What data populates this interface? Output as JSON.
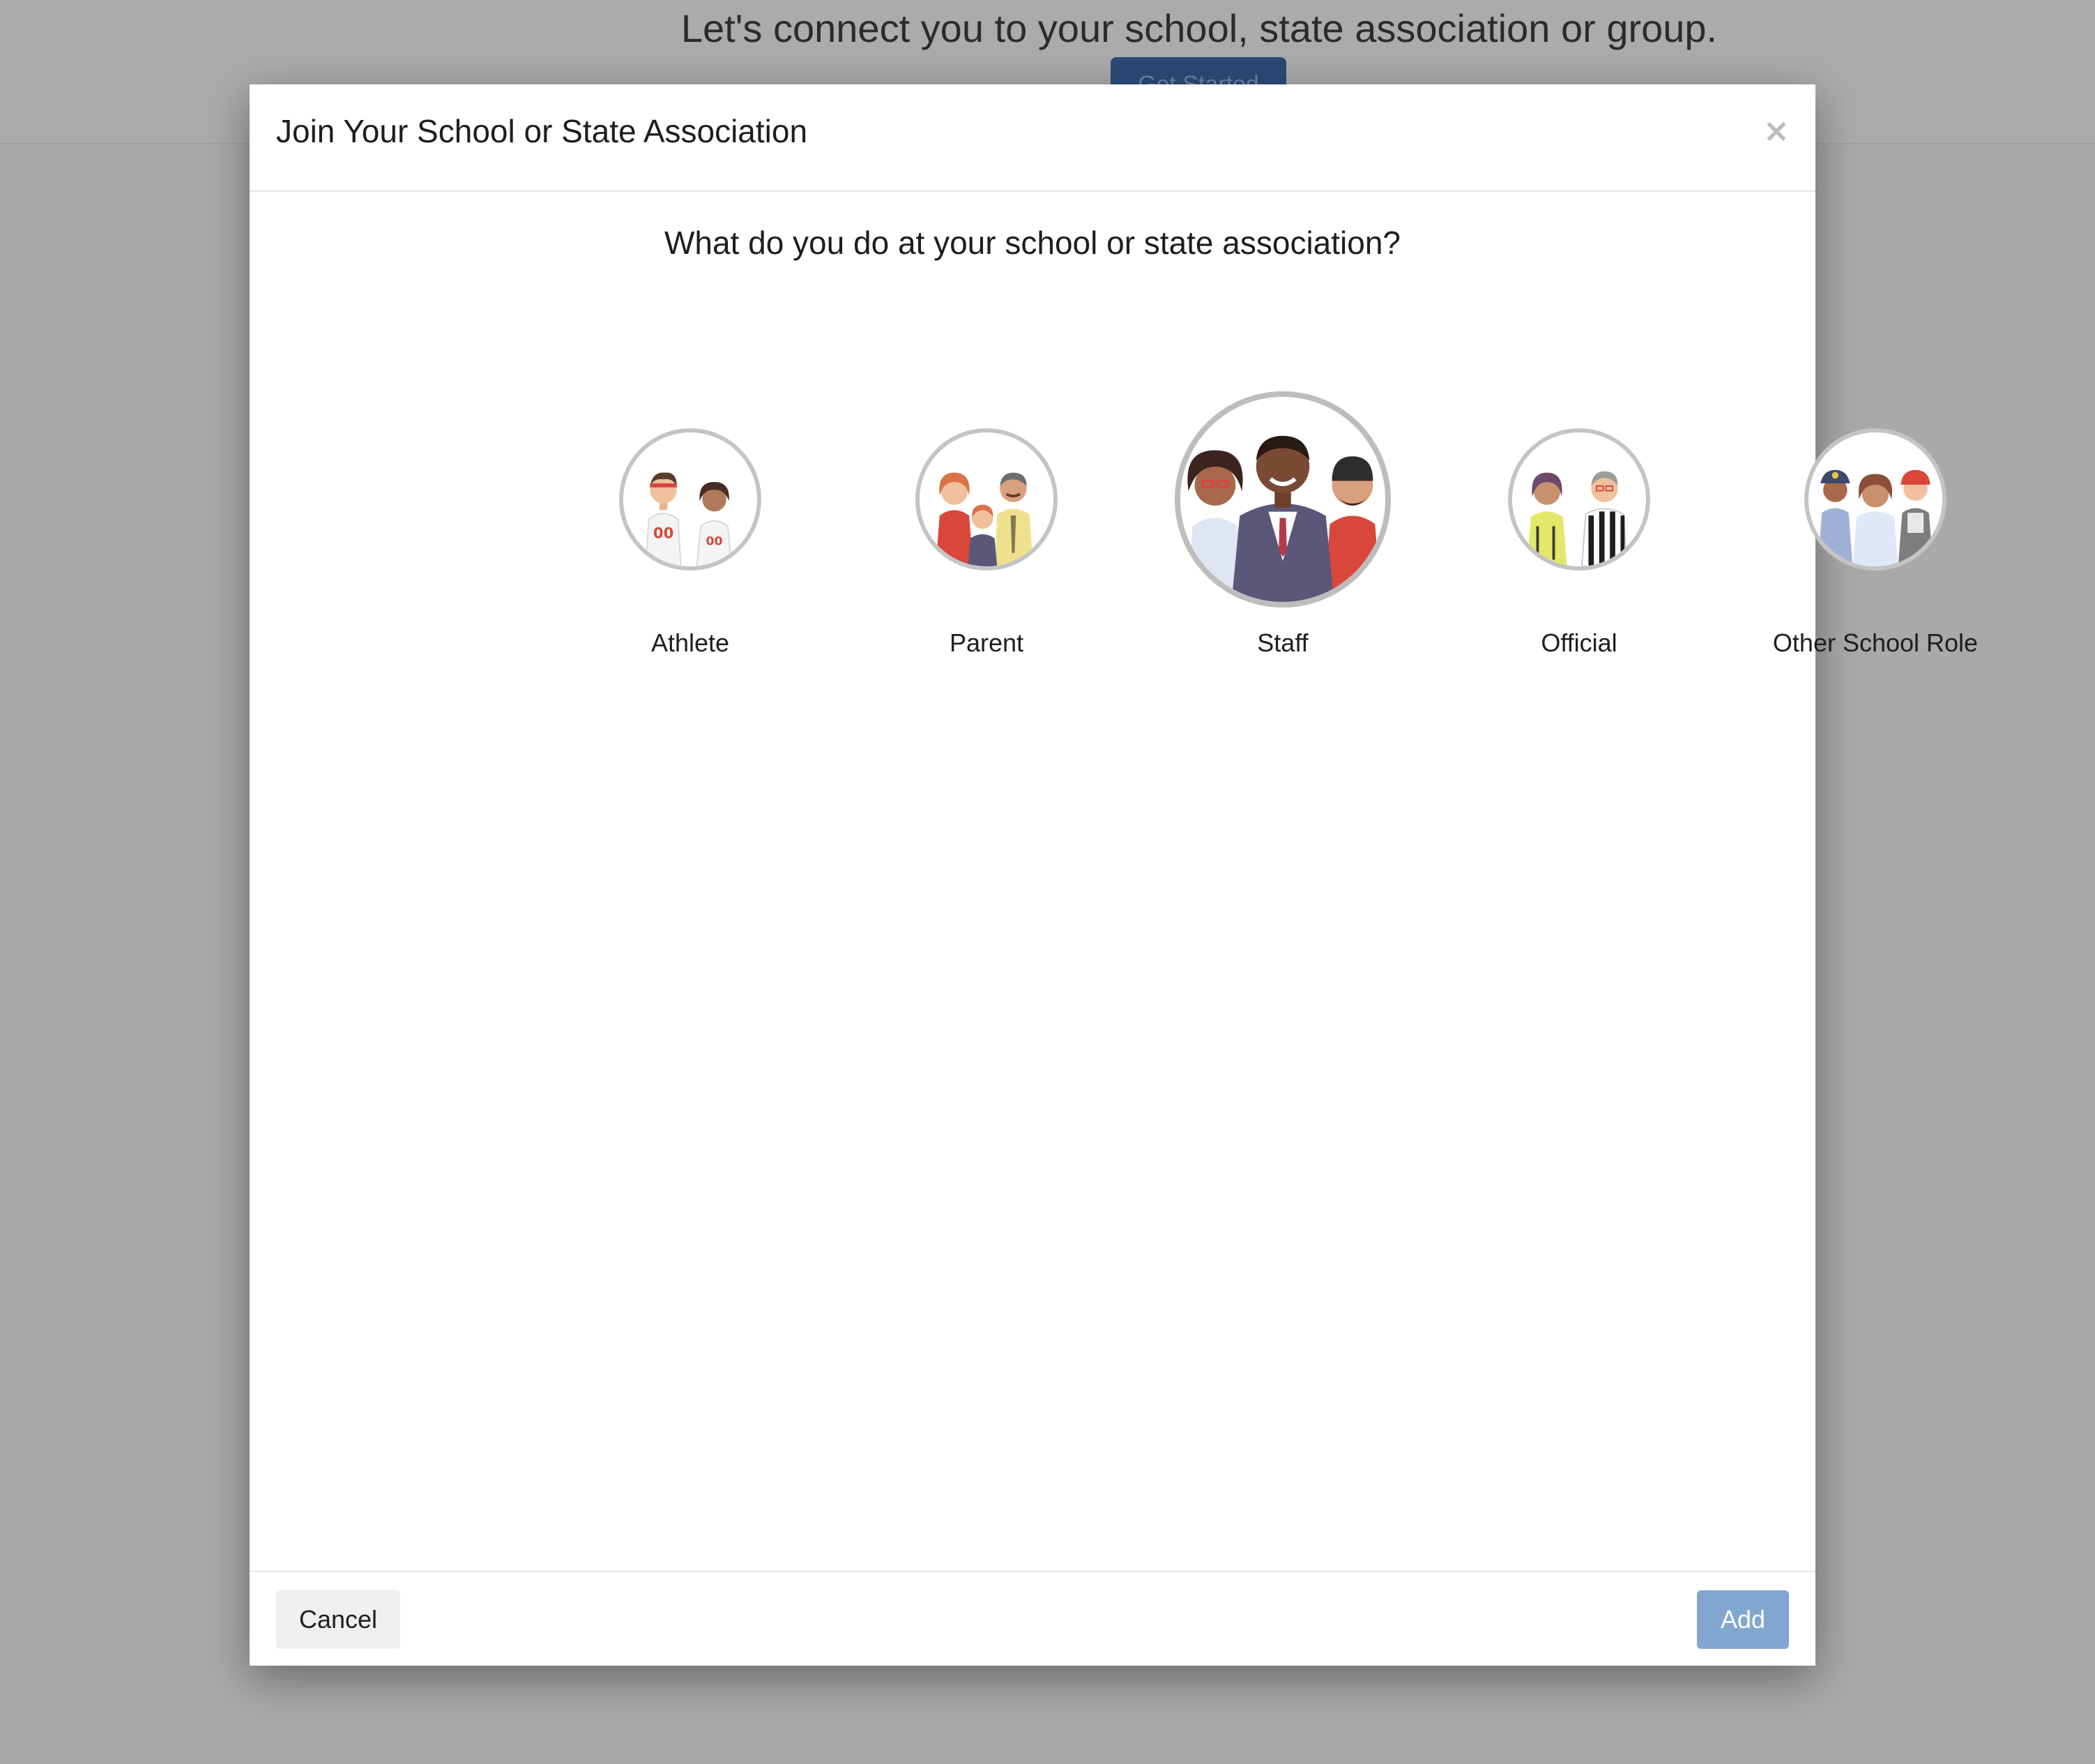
{
  "background": {
    "headline": "Let's connect you to your school, state association or group.",
    "cta_label": "Get Started"
  },
  "modal": {
    "title": "Join Your School or State Association",
    "close_glyph": "×",
    "question": "What do you do at your school or state association?",
    "roles": [
      {
        "label": "Athlete",
        "icon": "athletes-icon",
        "selected": false
      },
      {
        "label": "Parent",
        "icon": "parent-family-icon",
        "selected": false
      },
      {
        "label": "Staff",
        "icon": "staff-group-icon",
        "selected": true
      },
      {
        "label": "Official",
        "icon": "officials-icon",
        "selected": false
      },
      {
        "label": "Other School Role",
        "icon": "other-roles-icon",
        "selected": false
      }
    ],
    "cancel_label": "Cancel",
    "add_label": "Add"
  },
  "colors": {
    "overlay": "#a9a9a9",
    "primary_disabled": "#81a7d1",
    "cta_blue": "#2c4a78",
    "ring_gray": "#c4c4c4"
  }
}
